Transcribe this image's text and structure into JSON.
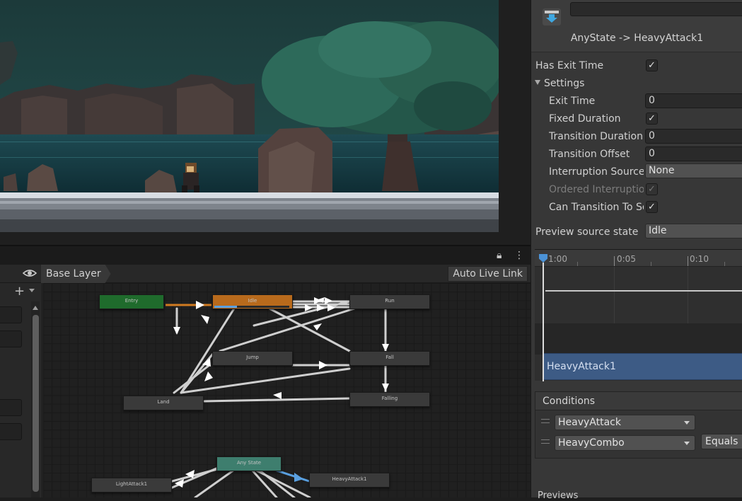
{
  "colors": {
    "entry": "#1f6b2c",
    "idle": "#b86a1c",
    "any_state": "#3e7e6e",
    "active_transition": "#5aa0e0",
    "clip": "#3d5b85"
  },
  "animator": {
    "layer_name": "Base Layer",
    "auto_live_link_label": "Auto Live Link",
    "icons": {
      "lock": "lock-icon",
      "menu": "kebab-menu-icon",
      "eye": "eye-icon",
      "add": "plus-icon"
    },
    "states": [
      {
        "label": "Entry"
      },
      {
        "label": "Idle",
        "progress": 0.3
      },
      {
        "label": "Run"
      },
      {
        "label": "Jump"
      },
      {
        "label": "Fall"
      },
      {
        "label": "Land"
      },
      {
        "label": "Falling"
      },
      {
        "label": "Any State"
      },
      {
        "label": "LightAttack1"
      },
      {
        "label": "HeavyAttack1"
      }
    ]
  },
  "inspector": {
    "title": "AnyState -> HeavyAttack1",
    "has_exit_time_label": "Has Exit Time",
    "has_exit_time": true,
    "settings_label": "Settings",
    "exit_time_label": "Exit Time",
    "exit_time_value": "0",
    "fixed_duration_label": "Fixed Duration",
    "fixed_duration": true,
    "transition_duration_label": "Transition Duration",
    "transition_duration_value": "0",
    "transition_offset_label": "Transition Offset",
    "transition_offset_value": "0",
    "interruption_source_label": "Interruption Source",
    "interruption_source_value": "None",
    "ordered_interruption_label": "Ordered Interruption",
    "ordered_interruption": true,
    "can_transition_label": "Can Transition To Self",
    "can_transition": true,
    "preview_source_label": "Preview source state",
    "preview_source_value": "Idle",
    "timeline_ticks": [
      "1:00",
      "0:05",
      "0:10"
    ],
    "clip_label": "HeavyAttack1",
    "conditions_label": "Conditions",
    "conditions": [
      {
        "parameter": "HeavyAttack"
      },
      {
        "parameter": "HeavyCombo",
        "mode": "Equals"
      }
    ],
    "previews_label": "Previews",
    "checkmark": "✓"
  }
}
